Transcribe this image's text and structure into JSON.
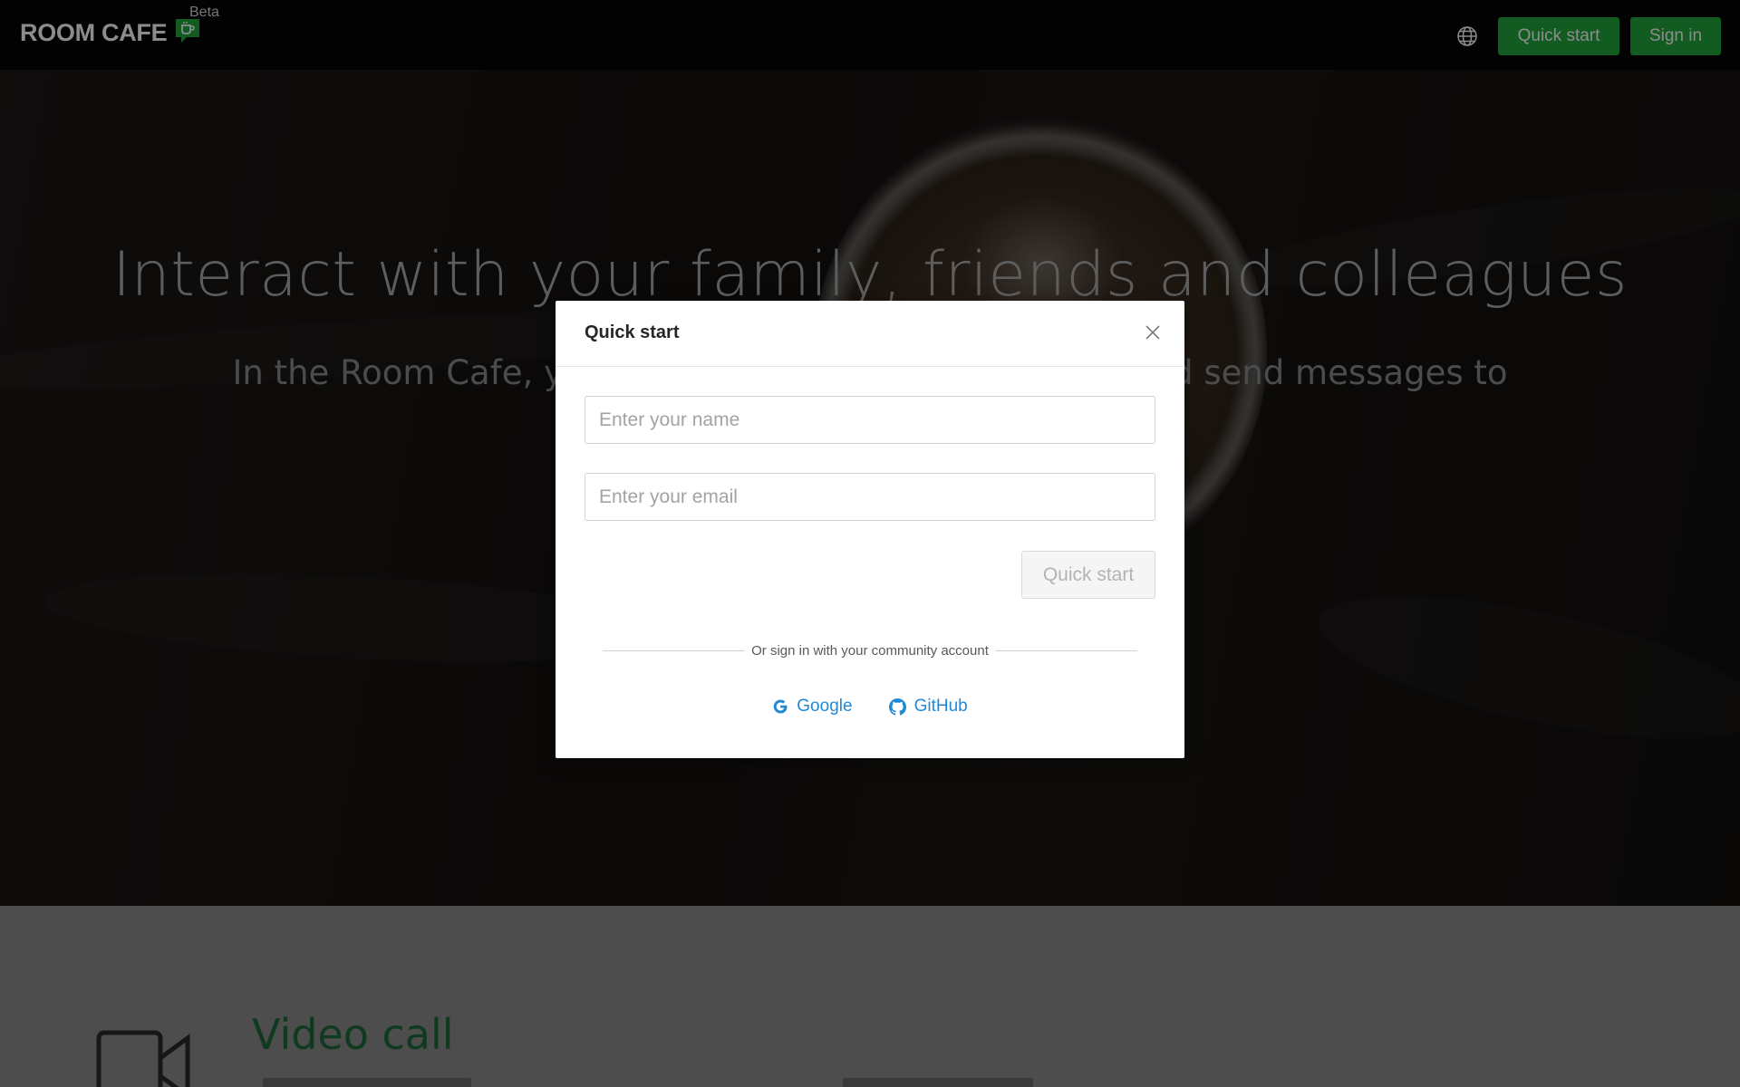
{
  "header": {
    "logo_text": "ROOM CAFE",
    "beta_label": "Beta",
    "language_icon": "globe-icon",
    "quick_start_label": "Quick start",
    "sign_in_label": "Sign in",
    "brand_color": "#22a83f"
  },
  "hero": {
    "title": "Interact with your family, friends and colleagues",
    "subtitle": "In the Room Cafe, you ca                                        as and send messages to"
  },
  "features": {
    "video_icon": "video-camera-icon",
    "video_title": "Video call"
  },
  "modal": {
    "title": "Quick start",
    "close_icon": "close-icon",
    "name_placeholder": "Enter your name",
    "name_value": "",
    "email_placeholder": "Enter your email",
    "email_value": "",
    "submit_label": "Quick start",
    "divider_text": "Or sign in with your community account",
    "providers": [
      {
        "label": "Google",
        "icon": "google-icon"
      },
      {
        "label": "GitHub",
        "icon": "github-icon"
      }
    ],
    "link_color": "#1f8ad6"
  }
}
